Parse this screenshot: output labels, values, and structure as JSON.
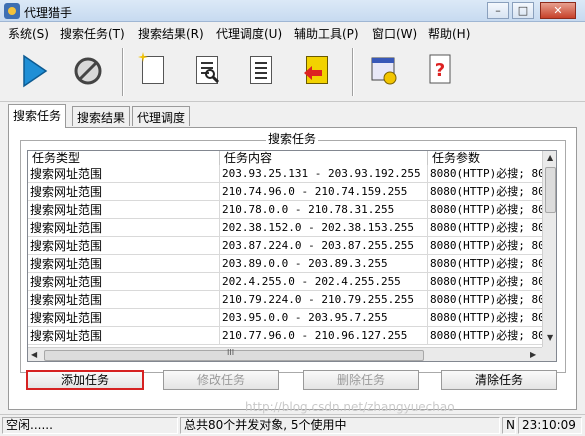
{
  "window": {
    "title": "代理猎手",
    "minimize": "–",
    "maximize": "□",
    "close": "✕"
  },
  "menu": [
    "系统(S)",
    "搜索任务(T)",
    "搜索结果(R)",
    "代理调度(U)",
    "辅助工具(P)",
    "窗口(W)",
    "帮助(H)"
  ],
  "toolbar": {
    "buttons": [
      "play-icon",
      "stop-icon",
      "new-document-icon",
      "search-document-icon",
      "list-document-icon",
      "export-icon",
      "settings-icon",
      "help-icon"
    ],
    "help_glyph": "?"
  },
  "tabs": [
    "搜索任务",
    "搜索结果",
    "代理调度"
  ],
  "group_title": "搜索任务",
  "table": {
    "columns": [
      "任务类型",
      "任务内容",
      "任务参数"
    ],
    "rows": [
      [
        "搜索网址范围",
        "203.93.25.131 - 203.93.192.255",
        "8080(HTTP)必搜; 80"
      ],
      [
        "搜索网址范围",
        "210.74.96.0 - 210.74.159.255",
        "8080(HTTP)必搜; 80"
      ],
      [
        "搜索网址范围",
        "210.78.0.0 - 210.78.31.255",
        "8080(HTTP)必搜; 80"
      ],
      [
        "搜索网址范围",
        "202.38.152.0 - 202.38.153.255",
        "8080(HTTP)必搜; 80"
      ],
      [
        "搜索网址范围",
        "203.87.224.0 - 203.87.255.255",
        "8080(HTTP)必搜; 80"
      ],
      [
        "搜索网址范围",
        "203.89.0.0 - 203.89.3.255",
        "8080(HTTP)必搜; 80"
      ],
      [
        "搜索网址范围",
        "202.4.255.0 - 202.4.255.255",
        "8080(HTTP)必搜; 80"
      ],
      [
        "搜索网址范围",
        "210.79.224.0 - 210.79.255.255",
        "8080(HTTP)必搜; 80"
      ],
      [
        "搜索网址范围",
        "203.95.0.0 - 203.95.7.255",
        "8080(HTTP)必搜; 80"
      ],
      [
        "搜索网址范围",
        "210.77.96.0 - 210.96.127.255",
        "8080(HTTP)必搜; 80"
      ]
    ],
    "hscroll_grip": "III",
    "arrows": {
      "up": "▲",
      "down": "▼",
      "left": "◀",
      "right": "▶"
    }
  },
  "buttons": {
    "add": "添加任务",
    "edit": "修改任务",
    "delete": "删除任务",
    "clear": "清除任务"
  },
  "status": {
    "state": "空闲......",
    "summary": "总共80个并发对象, 5个使用中",
    "mode": "N",
    "time": "23:10:09"
  },
  "watermark": "http://blog.csdn.net/zhangyuechao"
}
